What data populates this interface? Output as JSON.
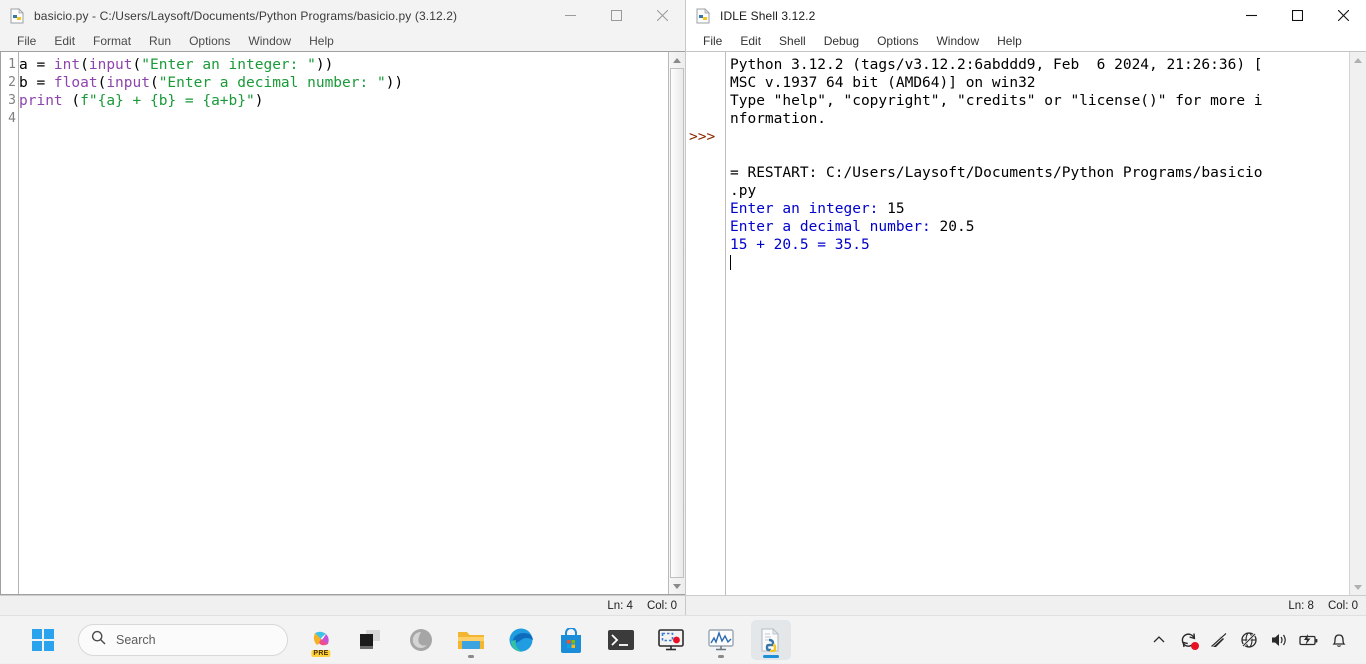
{
  "editor": {
    "title": "basicio.py - C:/Users/Laysoft/Documents/Python Programs/basicio.py (3.12.2)",
    "icon": "python-file-icon",
    "menus": [
      "File",
      "Edit",
      "Format",
      "Run",
      "Options",
      "Window",
      "Help"
    ],
    "window_controls": {
      "minimize": "minimize-icon",
      "maximize": "maximize-icon",
      "close": "close-icon"
    },
    "line_numbers": [
      "1",
      "2",
      "3",
      "4"
    ],
    "code_lines": [
      [
        {
          "t": "a = ",
          "c": "plain"
        },
        {
          "t": "int",
          "c": "builtin"
        },
        {
          "t": "(",
          "c": "plain"
        },
        {
          "t": "input",
          "c": "builtin"
        },
        {
          "t": "(",
          "c": "plain"
        },
        {
          "t": "\"Enter an integer: \"",
          "c": "str"
        },
        {
          "t": "))",
          "c": "plain"
        }
      ],
      [
        {
          "t": "b = ",
          "c": "plain"
        },
        {
          "t": "float",
          "c": "builtin"
        },
        {
          "t": "(",
          "c": "plain"
        },
        {
          "t": "input",
          "c": "builtin"
        },
        {
          "t": "(",
          "c": "plain"
        },
        {
          "t": "\"Enter a decimal number: \"",
          "c": "str"
        },
        {
          "t": "))",
          "c": "plain"
        }
      ],
      [
        {
          "t": "print",
          "c": "builtin"
        },
        {
          "t": " (",
          "c": "plain"
        },
        {
          "t": "f\"{a} + {b} = {a+b}\"",
          "c": "str"
        },
        {
          "t": ")",
          "c": "plain"
        }
      ],
      []
    ],
    "status": {
      "line_label": "Ln: 4",
      "col_label": "Col: 0"
    }
  },
  "shell": {
    "title": "IDLE Shell 3.12.2",
    "icon": "python-file-icon",
    "menus": [
      "File",
      "Edit",
      "Shell",
      "Debug",
      "Options",
      "Window",
      "Help"
    ],
    "window_controls": {
      "minimize": "minimize-icon",
      "maximize": "maximize-icon",
      "close": "close-icon"
    },
    "prompt_symbol": ">>>",
    "prompt_rows": [
      4,
      13
    ],
    "output_lines": [
      [
        {
          "t": "Python 3.12.2 (tags/v3.12.2:6abddd9, Feb  6 2024, 21:26:36) [",
          "c": "norm"
        }
      ],
      [
        {
          "t": "MSC v.1937 64 bit (AMD64)] on win32",
          "c": "norm"
        }
      ],
      [
        {
          "t": "Type \"help\", \"copyright\", \"credits\" or \"license()\" for more i",
          "c": "norm"
        }
      ],
      [
        {
          "t": "nformation.",
          "c": "norm"
        }
      ],
      [
        {
          "t": "",
          "c": "norm"
        }
      ],
      [
        {
          "t": "",
          "c": "norm"
        }
      ],
      [
        {
          "t": "= RESTART: C:/Users/Laysoft/Documents/Python Programs/basicio",
          "c": "norm"
        }
      ],
      [
        {
          "t": ".py",
          "c": "norm"
        }
      ],
      [
        {
          "t": "Enter an integer: ",
          "c": "out"
        },
        {
          "t": "15",
          "c": "norm"
        }
      ],
      [
        {
          "t": "Enter a decimal number: ",
          "c": "out"
        },
        {
          "t": "20.5",
          "c": "norm"
        }
      ],
      [
        {
          "t": "15 + 20.5 = 35.5",
          "c": "out"
        }
      ],
      [
        {
          "t": "",
          "c": "norm"
        }
      ]
    ],
    "status": {
      "line_label": "Ln: 8",
      "col_label": "Col: 0"
    }
  },
  "taskbar": {
    "start": "windows-logo-icon",
    "search": {
      "placeholder": "Search",
      "icon": "search-icon"
    },
    "items": [
      {
        "name": "copilot-preview-icon",
        "badge": "PRE",
        "running": false
      },
      {
        "name": "task-view-icon",
        "running": false
      },
      {
        "name": "copilot-icon",
        "running": false
      },
      {
        "name": "file-explorer-icon",
        "running": true
      },
      {
        "name": "microsoft-edge-icon",
        "running": false
      },
      {
        "name": "microsoft-store-icon",
        "running": false
      },
      {
        "name": "terminal-icon",
        "running": false
      },
      {
        "name": "screen-capture-icon",
        "running": false
      },
      {
        "name": "performance-monitor-icon",
        "running": true
      },
      {
        "name": "python-idle-icon",
        "running": true,
        "active": true
      }
    ],
    "tray": [
      {
        "name": "chevron-up-icon"
      },
      {
        "name": "sync-update-icon",
        "dot": true
      },
      {
        "name": "pen-disabled-icon"
      },
      {
        "name": "network-offline-icon"
      },
      {
        "name": "volume-icon"
      },
      {
        "name": "battery-charging-icon"
      },
      {
        "name": "notification-bell-icon"
      }
    ]
  },
  "colors": {
    "string_green": "#1a9a38",
    "builtin_purple": "#8e44ad",
    "stdout_blue": "#0000cd",
    "prompt_brown": "#8b2500",
    "taskbar_bg": "#f3f3f3"
  }
}
